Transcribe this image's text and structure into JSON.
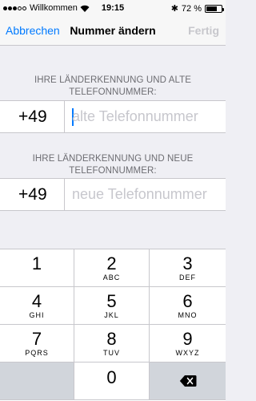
{
  "status_bar": {
    "carrier": "Willkommen",
    "time": "19:15",
    "battery_text": "72 %",
    "battery_level": 0.72
  },
  "nav": {
    "cancel_label": "Abbrechen",
    "title": "Nummer ändern",
    "done_label": "Fertig"
  },
  "old_number": {
    "header": "IHRE LÄNDERKENNUNG UND ALTE TELEFONNUMMER:",
    "country_code": "+49",
    "placeholder": "alte Telefonnummer"
  },
  "new_number": {
    "header": "IHRE LÄNDERKENNUNG UND NEUE TELEFONNUMMER:",
    "country_code": "+49",
    "placeholder": "neue Telefonnummer"
  },
  "keypad": {
    "keys": [
      {
        "digit": "1",
        "letters": ""
      },
      {
        "digit": "2",
        "letters": "ABC"
      },
      {
        "digit": "3",
        "letters": "DEF"
      },
      {
        "digit": "4",
        "letters": "GHI"
      },
      {
        "digit": "5",
        "letters": "JKL"
      },
      {
        "digit": "6",
        "letters": "MNO"
      },
      {
        "digit": "7",
        "letters": "PQRS"
      },
      {
        "digit": "8",
        "letters": "TUV"
      },
      {
        "digit": "9",
        "letters": "WXYZ"
      },
      {
        "digit": "0",
        "letters": ""
      }
    ],
    "delete_icon": "backspace-icon"
  }
}
